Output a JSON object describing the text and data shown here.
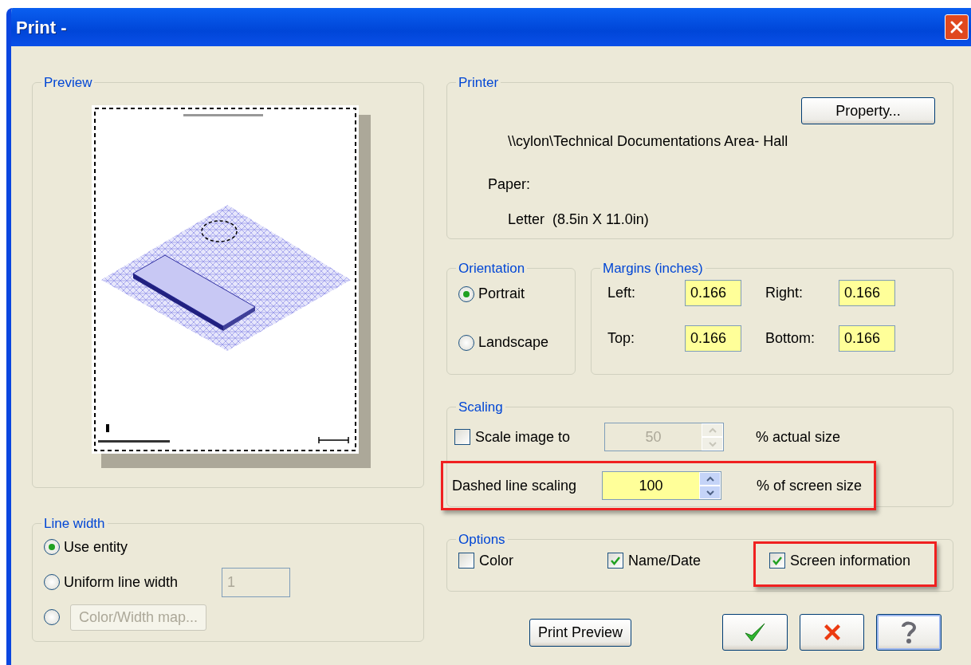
{
  "window": {
    "title": "Print -"
  },
  "preview": {
    "title": "Preview"
  },
  "line_width": {
    "title": "Line width",
    "options": [
      {
        "kind": "plain",
        "label": "Use entity",
        "selected": true
      },
      {
        "kind": "field",
        "label": "Uniform line width",
        "selected": false,
        "value": "1"
      },
      {
        "kind": "button",
        "label": "Color/Width map...",
        "selected": false
      }
    ]
  },
  "printer": {
    "title": "Printer",
    "property_button": "Property...",
    "name": "\\\\cylon\\Technical Documentations Area-  Hall",
    "paper_label": "Paper:",
    "paper": "Letter  (8.5in X 11.0in)"
  },
  "orientation": {
    "title": "Orientation",
    "options": [
      {
        "label": "Portrait",
        "selected": true
      },
      {
        "label": "Landscape",
        "selected": false
      }
    ]
  },
  "margins": {
    "title": "Margins (inches)",
    "fields": [
      {
        "label": "Left:",
        "value": "0.166"
      },
      {
        "label": "Right:",
        "value": "0.166"
      },
      {
        "label": "Top:",
        "value": "0.166"
      },
      {
        "label": "Bottom:",
        "value": "0.166"
      }
    ]
  },
  "scaling": {
    "title": "Scaling",
    "rows": [
      {
        "kind": "checkbox",
        "label": "Scale image to",
        "checked": false,
        "value": "50",
        "disabled": true,
        "unit": "% actual size",
        "highlighted": false
      },
      {
        "kind": "label",
        "label": "Dashed line scaling",
        "value": "100",
        "disabled": false,
        "unit": "% of screen size",
        "highlighted": true
      }
    ]
  },
  "options": {
    "title": "Options",
    "items": [
      {
        "label": "Color",
        "checked": false,
        "highlighted": false
      },
      {
        "label": "Name/Date",
        "checked": true,
        "highlighted": false
      },
      {
        "label": "Screen information",
        "checked": true,
        "highlighted": true
      }
    ]
  },
  "buttons": [
    {
      "kind": "text",
      "label": "Print Preview"
    },
    {
      "kind": "ok"
    },
    {
      "kind": "cancel"
    },
    {
      "kind": "help"
    }
  ]
}
